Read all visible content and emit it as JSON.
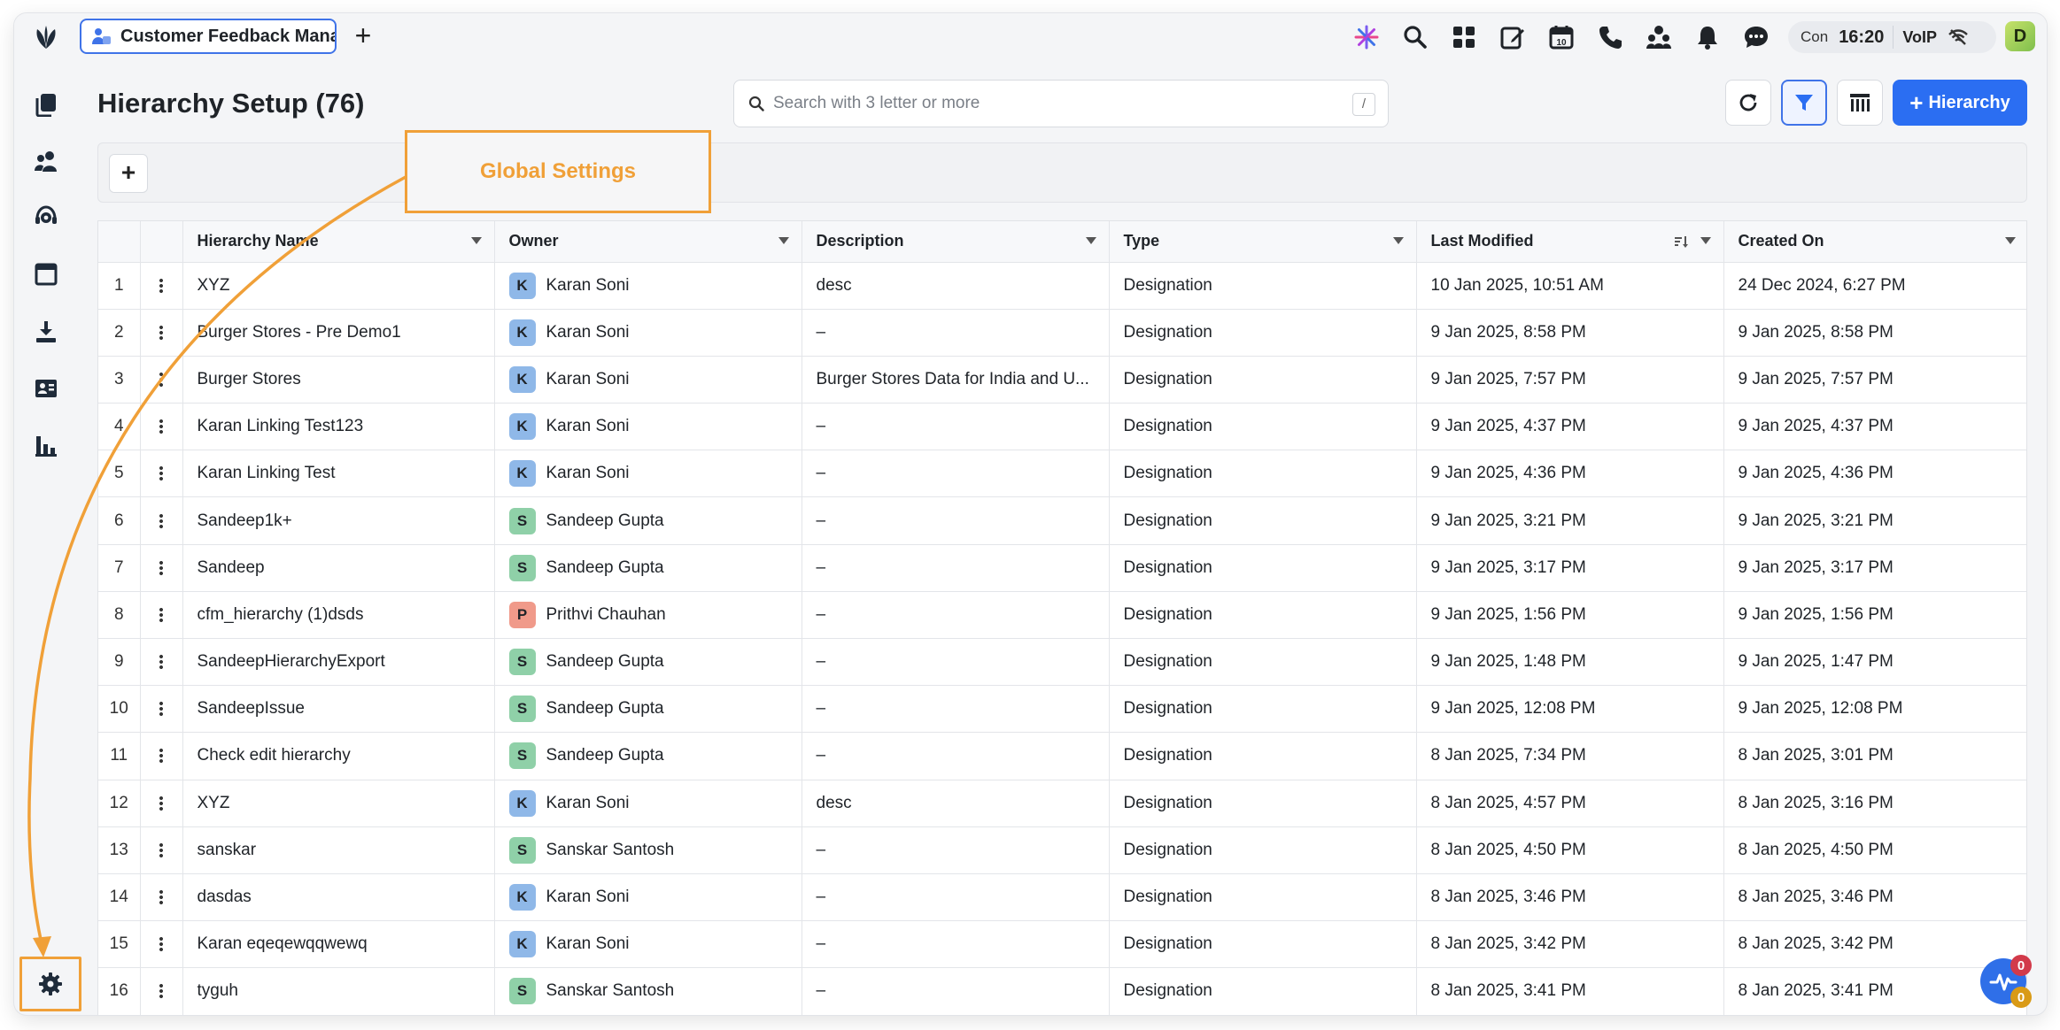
{
  "app_tab": {
    "label": "Customer Feedback Mana"
  },
  "topbar": {
    "icons": [
      "sparkle-icon",
      "search-icon",
      "apps-grid-icon",
      "edit-icon",
      "calendar-icon",
      "phone-icon",
      "people-icon",
      "bell-icon",
      "chat-icon"
    ],
    "calendar_day": "10",
    "status": {
      "con": "Con",
      "time": "16:20",
      "voip": "VoIP"
    },
    "user_initial": "D"
  },
  "sidebar": {
    "items": [
      "documents-icon",
      "users-icon",
      "support-icon",
      "window-icon",
      "download-icon",
      "directory-icon",
      "analytics-icon"
    ],
    "settings": "gear-icon"
  },
  "page": {
    "title": "Hierarchy Setup (76)",
    "search_placeholder": "Search with 3 letter or more",
    "search_shortcut": "/",
    "primary_button": "Hierarchy",
    "filter_add": "+"
  },
  "callout": {
    "label": "Global Settings"
  },
  "table": {
    "columns": [
      "Hierarchy Name",
      "Owner",
      "Description",
      "Type",
      "Last Modified",
      "Created On"
    ],
    "rows": [
      {
        "n": "1",
        "name": "XYZ",
        "owner_initial": "K",
        "owner": "Karan Soni",
        "desc": "desc",
        "type": "Designation",
        "modified": "10 Jan 2025, 10:51 AM",
        "created": "24 Dec 2024, 6:27 PM"
      },
      {
        "n": "2",
        "name": "Burger Stores - Pre Demo1",
        "owner_initial": "K",
        "owner": "Karan Soni",
        "desc": "–",
        "type": "Designation",
        "modified": "9 Jan 2025, 8:58 PM",
        "created": "9 Jan 2025, 8:58 PM"
      },
      {
        "n": "3",
        "name": "Burger Stores",
        "owner_initial": "K",
        "owner": "Karan Soni",
        "desc": "Burger Stores Data for India and U...",
        "type": "Designation",
        "modified": "9 Jan 2025, 7:57 PM",
        "created": "9 Jan 2025, 7:57 PM"
      },
      {
        "n": "4",
        "name": "Karan Linking Test123",
        "owner_initial": "K",
        "owner": "Karan Soni",
        "desc": "–",
        "type": "Designation",
        "modified": "9 Jan 2025, 4:37 PM",
        "created": "9 Jan 2025, 4:37 PM"
      },
      {
        "n": "5",
        "name": "Karan Linking Test",
        "owner_initial": "K",
        "owner": "Karan Soni",
        "desc": "–",
        "type": "Designation",
        "modified": "9 Jan 2025, 4:36 PM",
        "created": "9 Jan 2025, 4:36 PM"
      },
      {
        "n": "6",
        "name": "Sandeep1k+",
        "owner_initial": "S",
        "owner": "Sandeep Gupta",
        "desc": "–",
        "type": "Designation",
        "modified": "9 Jan 2025, 3:21 PM",
        "created": "9 Jan 2025, 3:21 PM"
      },
      {
        "n": "7",
        "name": "Sandeep",
        "owner_initial": "S",
        "owner": "Sandeep Gupta",
        "desc": "–",
        "type": "Designation",
        "modified": "9 Jan 2025, 3:17 PM",
        "created": "9 Jan 2025, 3:17 PM"
      },
      {
        "n": "8",
        "name": "cfm_hierarchy (1)dsds",
        "owner_initial": "P",
        "owner": "Prithvi Chauhan",
        "desc": "–",
        "type": "Designation",
        "modified": "9 Jan 2025, 1:56 PM",
        "created": "9 Jan 2025, 1:56 PM"
      },
      {
        "n": "9",
        "name": "SandeepHierarchyExport",
        "owner_initial": "S",
        "owner": "Sandeep Gupta",
        "desc": "–",
        "type": "Designation",
        "modified": "9 Jan 2025, 1:48 PM",
        "created": "9 Jan 2025, 1:47 PM"
      },
      {
        "n": "10",
        "name": "SandeepIssue",
        "owner_initial": "S",
        "owner": "Sandeep Gupta",
        "desc": "–",
        "type": "Designation",
        "modified": "9 Jan 2025, 12:08 PM",
        "created": "9 Jan 2025, 12:08 PM"
      },
      {
        "n": "11",
        "name": "Check edit hierarchy",
        "owner_initial": "S",
        "owner": "Sandeep Gupta",
        "desc": "–",
        "type": "Designation",
        "modified": "8 Jan 2025, 7:34 PM",
        "created": "8 Jan 2025, 3:01 PM"
      },
      {
        "n": "12",
        "name": "XYZ",
        "owner_initial": "K",
        "owner": "Karan Soni",
        "desc": "desc",
        "type": "Designation",
        "modified": "8 Jan 2025, 4:57 PM",
        "created": "8 Jan 2025, 3:16 PM"
      },
      {
        "n": "13",
        "name": "sanskar",
        "owner_initial": "S",
        "owner": "Sanskar Santosh",
        "desc": "–",
        "type": "Designation",
        "modified": "8 Jan 2025, 4:50 PM",
        "created": "8 Jan 2025, 4:50 PM"
      },
      {
        "n": "14",
        "name": "dasdas",
        "owner_initial": "K",
        "owner": "Karan Soni",
        "desc": "–",
        "type": "Designation",
        "modified": "8 Jan 2025, 3:46 PM",
        "created": "8 Jan 2025, 3:46 PM"
      },
      {
        "n": "15",
        "name": "Karan eqeqewqqwewq",
        "owner_initial": "K",
        "owner": "Karan Soni",
        "desc": "–",
        "type": "Designation",
        "modified": "8 Jan 2025, 3:42 PM",
        "created": "8 Jan 2025, 3:42 PM"
      },
      {
        "n": "16",
        "name": "tyguh",
        "owner_initial": "S",
        "owner": "Sanskar Santosh",
        "desc": "–",
        "type": "Designation",
        "modified": "8 Jan 2025, 3:41 PM",
        "created": "8 Jan 2025, 3:41 PM"
      }
    ]
  },
  "widget": {
    "badge_top": "0",
    "badge_bottom": "0"
  },
  "colors": {
    "accent": "#2b6ef2",
    "annotation": "#f0a038",
    "badge_k": "#8fb8e8",
    "badge_s": "#8fd0a8",
    "badge_p": "#f09a8a"
  }
}
